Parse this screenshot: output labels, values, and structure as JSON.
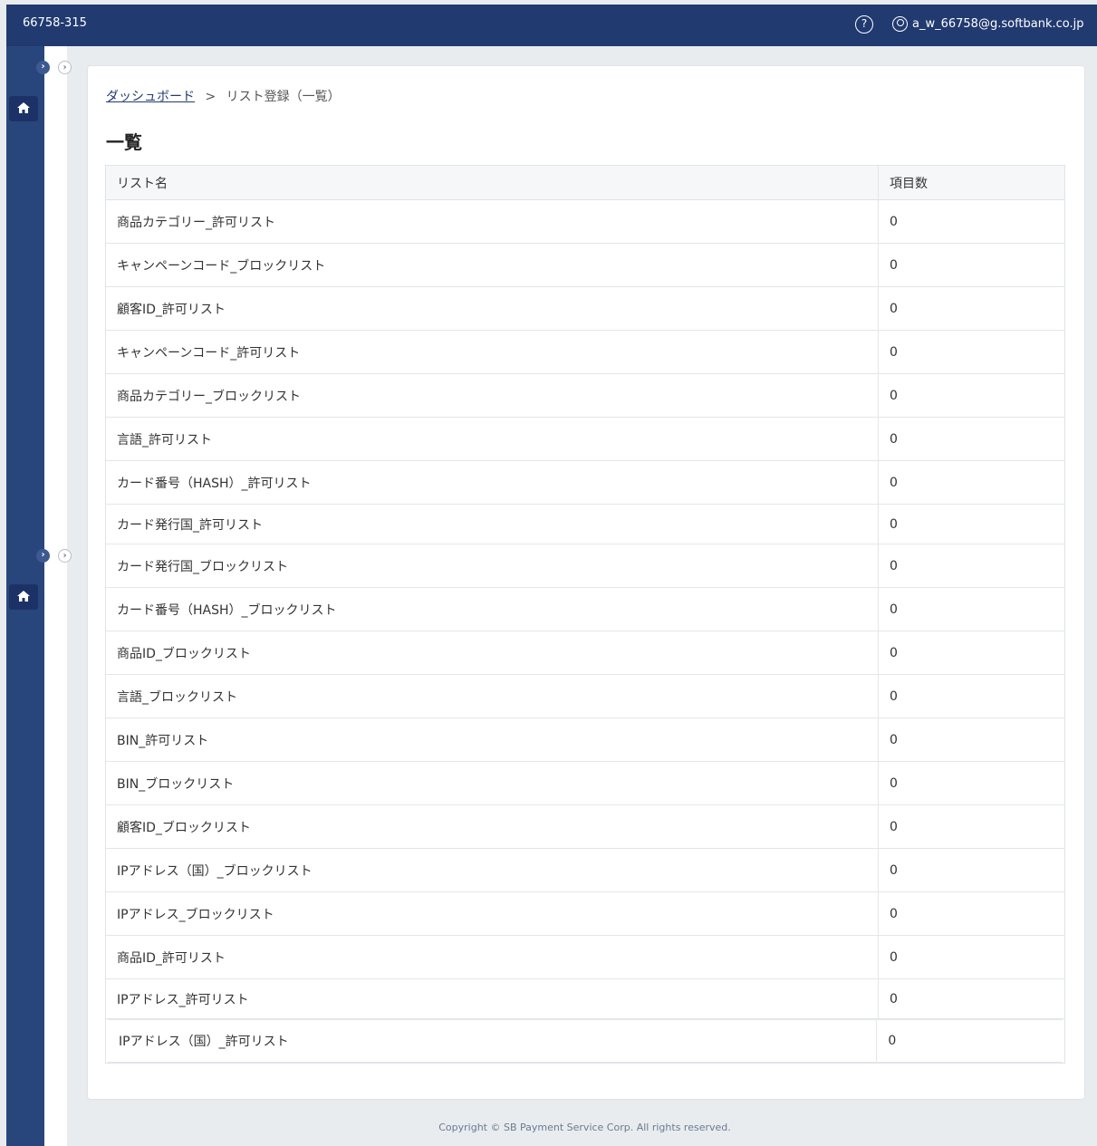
{
  "header": {
    "account_id": "66758-315",
    "help_icon": "?",
    "user_email": "a_w_66758@g.softbank.co.jp"
  },
  "sidebar": {
    "toggle_glyph": "›"
  },
  "breadcrumb": {
    "home_link": "ダッシュボード",
    "separator": ">",
    "current": "リスト登録（一覧）"
  },
  "page": {
    "title": "一覧"
  },
  "table": {
    "headers": {
      "name": "リスト名",
      "count": "項目数"
    },
    "rows": [
      {
        "name": "商品カテゴリー_許可リスト",
        "count": "0"
      },
      {
        "name": "キャンペーンコード_ブロックリスト",
        "count": "0"
      },
      {
        "name": "顧客ID_許可リスト",
        "count": "0"
      },
      {
        "name": "キャンペーンコード_許可リスト",
        "count": "0"
      },
      {
        "name": "商品カテゴリー_ブロックリスト",
        "count": "0"
      },
      {
        "name": "言語_許可リスト",
        "count": "0"
      },
      {
        "name": "カード番号（HASH）_許可リスト",
        "count": "0"
      },
      {
        "name": "カード発行国_許可リスト",
        "count": "0"
      },
      {
        "name": "カード発行国_ブロックリスト",
        "count": "0"
      },
      {
        "name": "カード番号（HASH）_ブロックリスト",
        "count": "0"
      },
      {
        "name": "商品ID_ブロックリスト",
        "count": "0"
      },
      {
        "name": "言語_ブロックリスト",
        "count": "0"
      },
      {
        "name": "BIN_許可リスト",
        "count": "0"
      },
      {
        "name": "BIN_ブロックリスト",
        "count": "0"
      },
      {
        "name": "顧客ID_ブロックリスト",
        "count": "0"
      },
      {
        "name": "IPアドレス（国）_ブロックリスト",
        "count": "0"
      },
      {
        "name": "IPアドレス_ブロックリスト",
        "count": "0"
      },
      {
        "name": "商品ID_許可リスト",
        "count": "0"
      },
      {
        "name": "IPアドレス_許可リスト",
        "count": "0"
      },
      {
        "name": "IPアドレス（国）_許可リスト",
        "count": "0"
      }
    ]
  },
  "footer": {
    "copyright": "Copyright © SB Payment Service Corp. All rights reserved."
  },
  "colors": {
    "header_bg": "#213a70",
    "sidebar_bg": "#29467c",
    "link": "#213a70"
  }
}
